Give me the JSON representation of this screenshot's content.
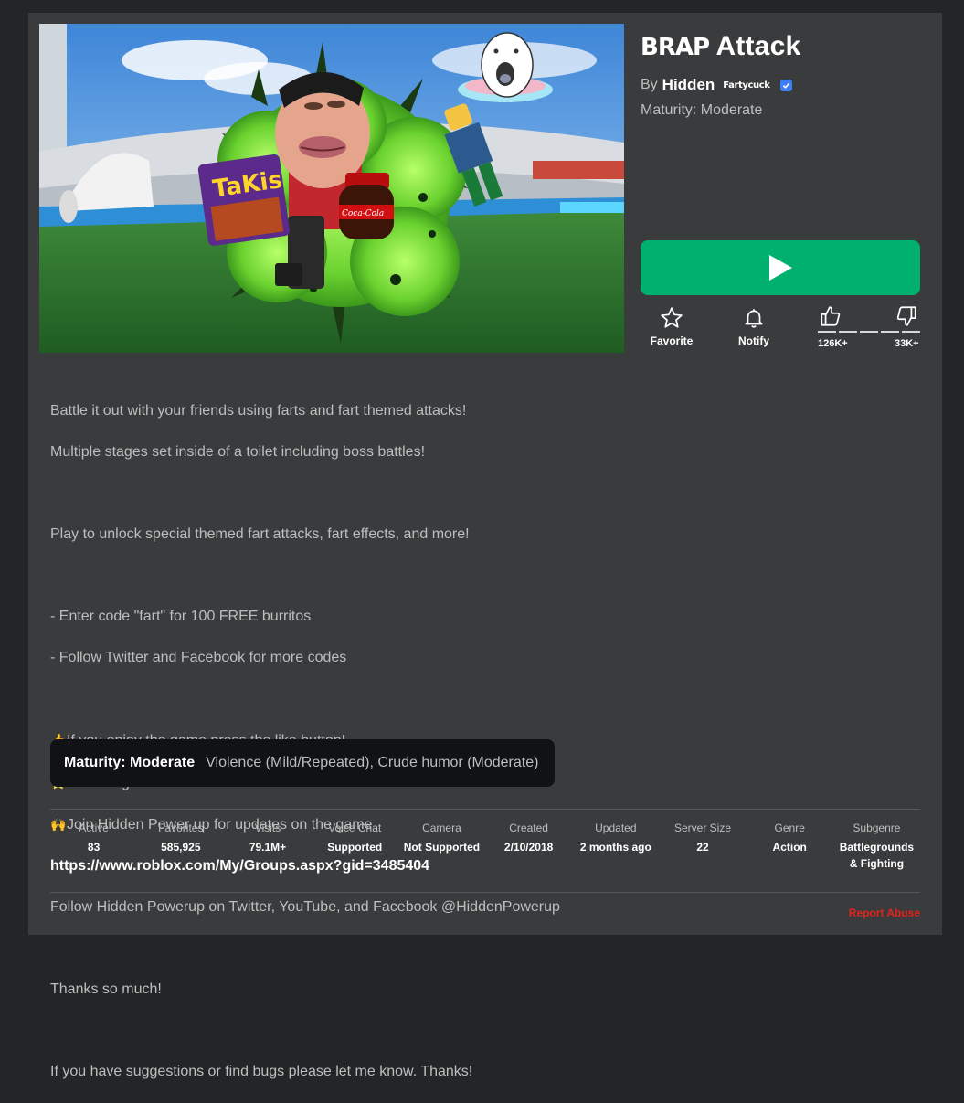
{
  "game": {
    "title_prefix": "BRAP",
    "title_main": "Attack",
    "by_label": "By",
    "creator": "Hidden",
    "creator_tag": "Fartycuck",
    "maturity_line": "Maturity: Moderate"
  },
  "thumbnail": {
    "takis_text": "TaKis",
    "coke_text": "Coca-Cola"
  },
  "actions": {
    "favorite_label": "Favorite",
    "notify_label": "Notify",
    "upvotes": "126K+",
    "downvotes": "33K+"
  },
  "description": {
    "lines": [
      "Battle it out with your friends using farts and fart themed attacks!",
      "Multiple stages set inside of a toilet including boss battles!",
      "",
      "Play to unlock special themed fart attacks, fart effects, and more!",
      "",
      "- Enter code \"fart\" for 100 FREE burritos",
      "- Follow Twitter and Facebook for more codes",
      ""
    ],
    "emoji_lines": [
      {
        "emoji": "👍",
        "text": "If you enjoy the game press the like button!"
      },
      {
        "emoji": "⭐",
        "text": "Don't forget to favorite!"
      },
      {
        "emoji": "🙌",
        "text": "Join Hidden Power up for updates on the game"
      }
    ],
    "link": "https://www.roblox.com/My/Groups.aspx?gid=3485404",
    "follow_line": "Follow Hidden Powerup on Twitter, YouTube, and Facebook @HiddenPowerup",
    "thanks": "Thanks so much!",
    "suggestions": "If you have suggestions or find bugs please let me know.  Thanks!"
  },
  "maturity_box": {
    "label": "Maturity: Moderate",
    "value": "Violence (Mild/Repeated), Crude humor (Moderate)"
  },
  "stats": [
    {
      "label": "Active",
      "value": "83"
    },
    {
      "label": "Favorites",
      "value": "585,925"
    },
    {
      "label": "Visits",
      "value": "79.1M+"
    },
    {
      "label": "Voice Chat",
      "value": "Supported"
    },
    {
      "label": "Camera",
      "value": "Not Supported"
    },
    {
      "label": "Created",
      "value": "2/10/2018"
    },
    {
      "label": "Updated",
      "value": "2 months ago"
    },
    {
      "label": "Server Size",
      "value": "22"
    },
    {
      "label": "Genre",
      "value": "Action"
    },
    {
      "label": "Subgenre",
      "value": "Battlegrounds & Fighting"
    }
  ],
  "report_label": "Report Abuse",
  "colors": {
    "play": "#00b06f",
    "panel": "#393b3d",
    "background": "#232527",
    "report": "#e2231a",
    "verified": "#3d7df5"
  }
}
